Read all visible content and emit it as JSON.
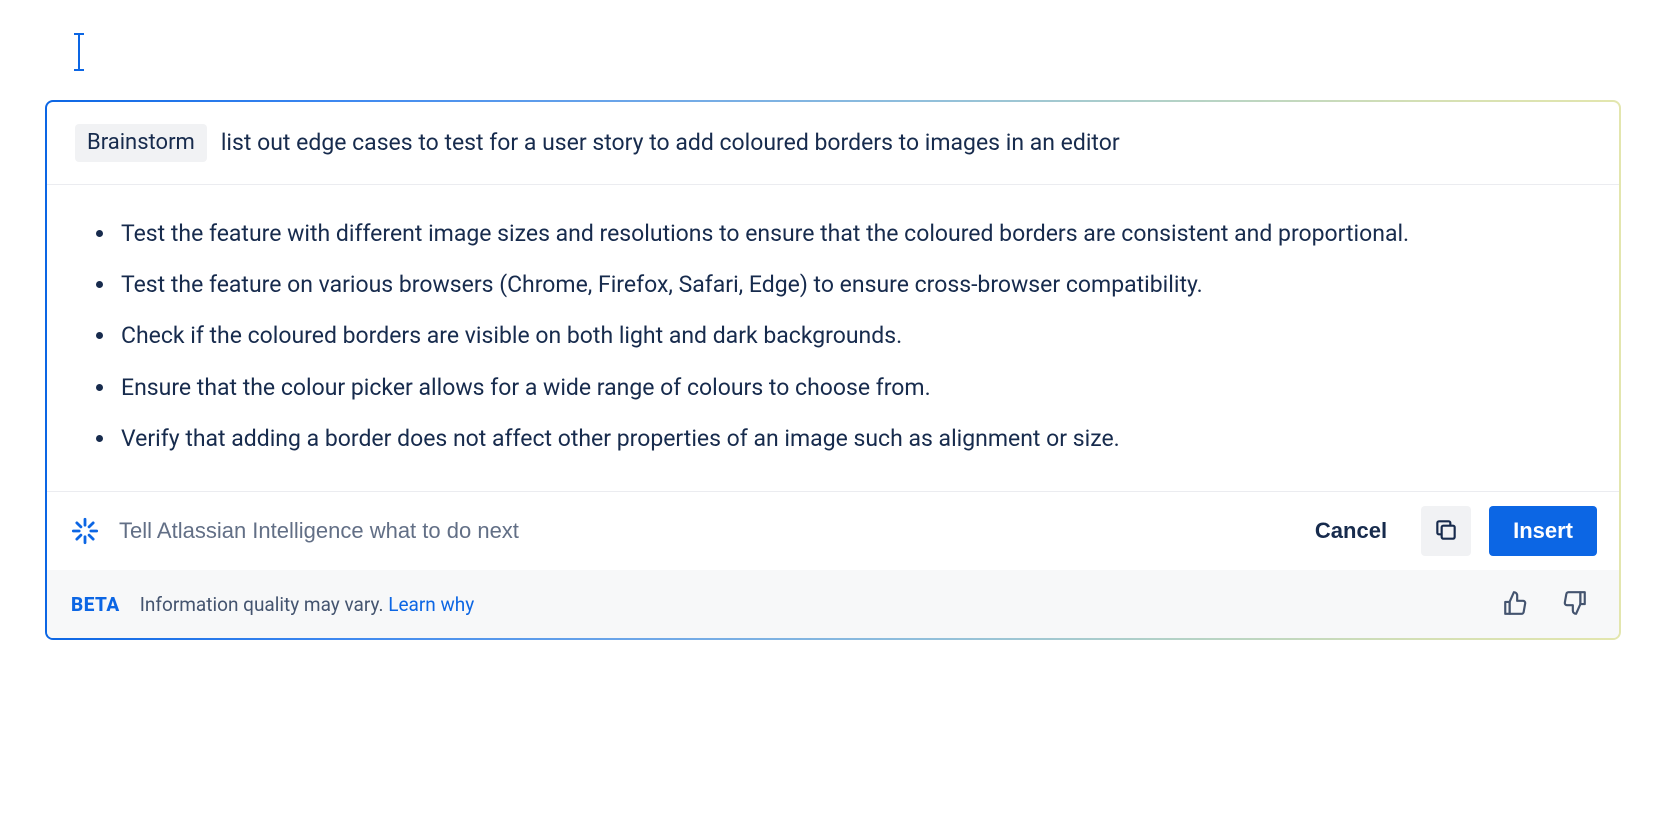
{
  "prompt": {
    "chip": "Brainstorm",
    "text": "list out edge cases to test for a user story to add coloured borders to images in an editor"
  },
  "results": [
    "Test the feature with different image sizes and resolutions to ensure that the coloured borders are consistent and proportional.",
    "Test the feature on various browsers (Chrome, Firefox, Safari, Edge) to ensure cross-browser compatibility.",
    "Check if the coloured borders are visible on both light and dark backgrounds.",
    "Ensure that the colour picker allows for a wide range of colours to choose from.",
    "Verify that adding a border does not affect other properties of an image such as alignment or size."
  ],
  "actions": {
    "placeholder": "Tell Atlassian Intelligence what to do next",
    "cancel": "Cancel",
    "insert": "Insert"
  },
  "footer": {
    "beta": "BETA",
    "quality": "Information quality may vary.",
    "learn": "Learn why"
  }
}
